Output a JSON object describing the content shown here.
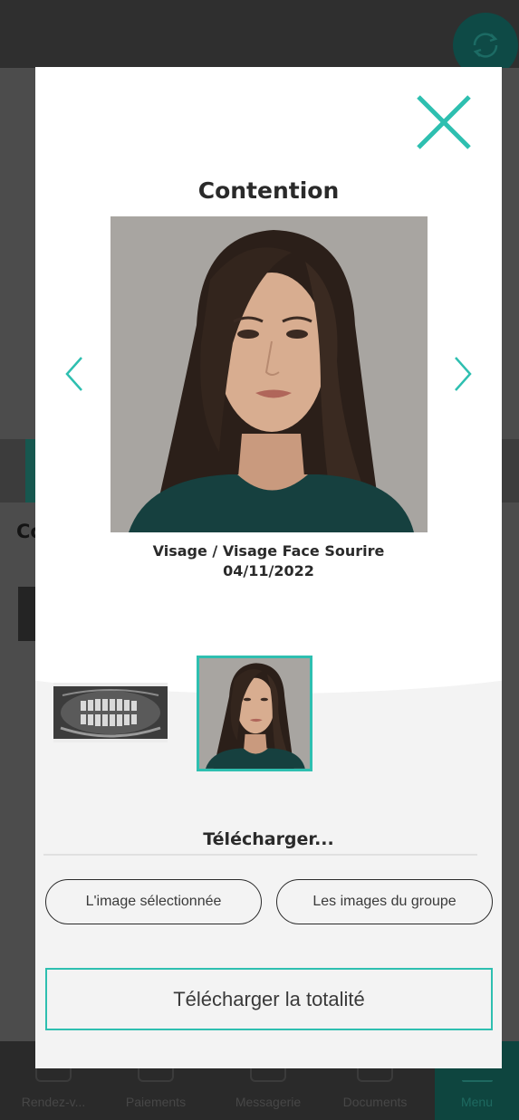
{
  "background": {
    "section_heading_partial": "Co",
    "nav": [
      {
        "label": "Rendez-v..."
      },
      {
        "label": "Paiements"
      },
      {
        "label": "Messagerie"
      },
      {
        "label": "Documents"
      },
      {
        "label": "Menu"
      }
    ],
    "accent": "#2ebfb0"
  },
  "modal": {
    "title": "Contention",
    "caption_line1": "Visage / Visage Face Sourire",
    "caption_line2": "04/11/2022",
    "thumbnails": [
      {
        "kind": "panoramic-xray",
        "selected": false
      },
      {
        "kind": "face-photo",
        "selected": true
      }
    ],
    "download_heading": "Télécharger...",
    "btn_selected_image": "L'image sélectionnée",
    "btn_group_images": "Les images du groupe",
    "btn_download_all": "Télécharger la totalité"
  },
  "colors": {
    "accent": "#2ebfb0",
    "overlay": "#4a4a4a",
    "modal_bg": "#f3f3f3"
  }
}
